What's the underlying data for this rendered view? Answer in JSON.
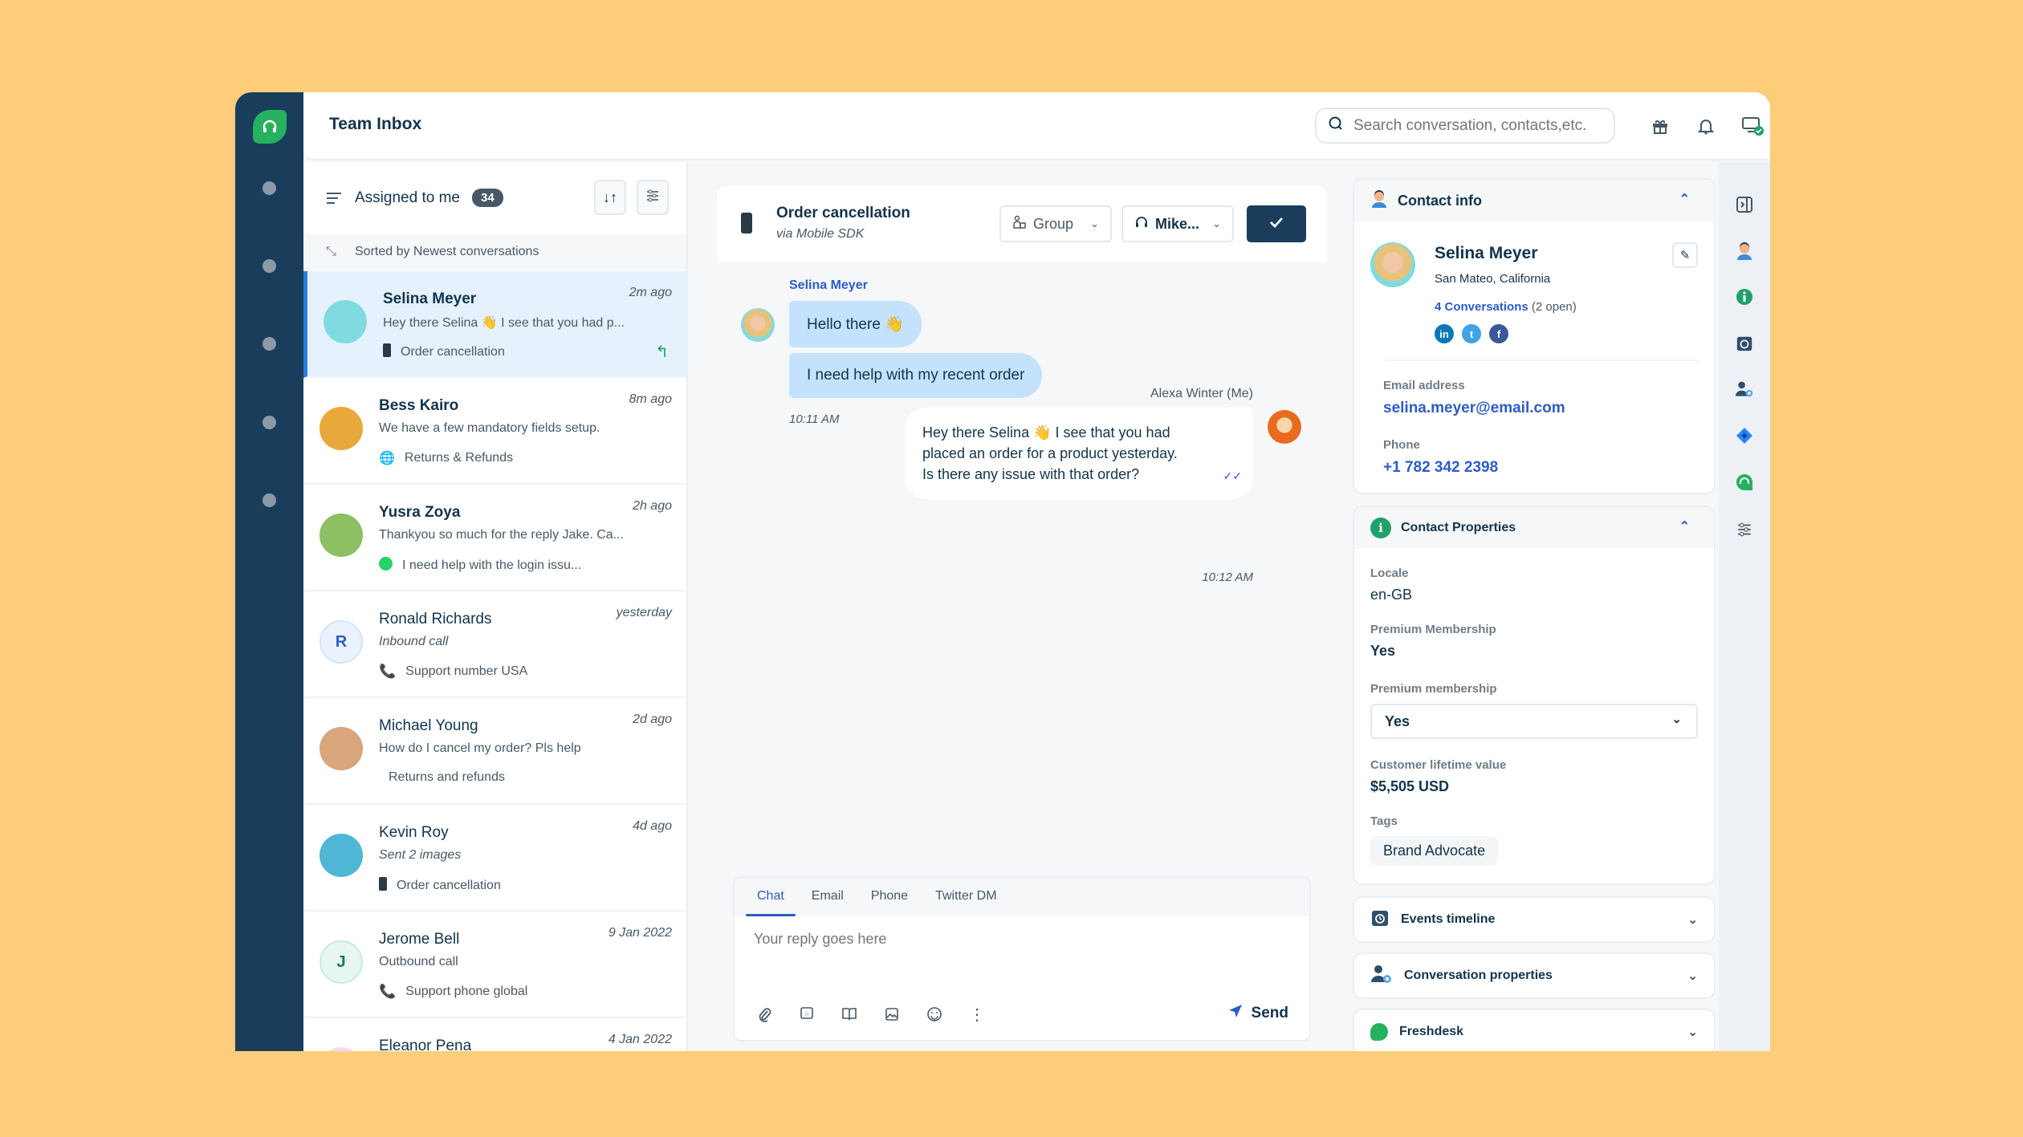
{
  "header": {
    "title": "Team Inbox",
    "search_placeholder": "Search conversation, contacts,etc.",
    "icons": [
      "gift-icon",
      "bell-icon",
      "status-monitor-icon",
      "user-avatar"
    ]
  },
  "nav": {
    "logo": "freshdesk-headset-logo",
    "items": [
      "nav-item-1",
      "nav-item-2",
      "nav-item-3",
      "nav-item-4",
      "nav-item-5"
    ]
  },
  "list": {
    "filter_label": "Assigned to me",
    "count": "34",
    "sort_label": "Sorted by Newest conversations",
    "conversations": [
      {
        "name": "Selina Meyer",
        "time": "2m ago",
        "preview": "Hey there Selina 👋 I see that you had p...",
        "channel_icon": "mobile-icon",
        "topic": "Order cancellation",
        "active": true,
        "bold": true,
        "avatar_color": "#7fdbe0"
      },
      {
        "name": "Bess Kairo",
        "time": "8m ago",
        "preview": "We have a few mandatory fields setup.",
        "channel_icon": "globe-icon",
        "topic": "Returns & Refunds",
        "bold": true,
        "avatar_color": "#e8a83a"
      },
      {
        "name": "Yusra Zoya",
        "time": "2h ago",
        "preview": "Thankyou so much for the reply Jake. Ca...",
        "channel_icon": "whatsapp-icon",
        "topic": "I need help with the login issu...",
        "bold": true,
        "avatar_color": "#8cc063"
      },
      {
        "name": "Ronald Richards",
        "time": "yesterday",
        "preview": "Inbound call",
        "channel_icon": "phone-icon",
        "topic": "Support number USA",
        "initial": "R",
        "italic": true,
        "avatar_color": "#eaf3fd"
      },
      {
        "name": "Michael Young",
        "time": "2d ago",
        "preview": "How do I cancel my order? Pls help",
        "channel_icon": "apple-icon",
        "topic": "Returns and refunds",
        "avatar_color": "#d9a57a"
      },
      {
        "name": "Kevin Roy",
        "time": "4d ago",
        "preview": "Sent 2 images",
        "channel_icon": "mobile-icon",
        "topic": "Order cancellation",
        "italic": true,
        "avatar_color": "#4fb6d6"
      },
      {
        "name": "Jerome Bell",
        "time": "9 Jan 2022",
        "preview": "Outbound call",
        "channel_icon": "phone-icon",
        "topic": "Support phone global",
        "initial": "J",
        "avatar_color": "#e6f7f2"
      },
      {
        "name": "Eleanor Pena",
        "time": "4 Jan 2022",
        "preview": "",
        "topic": "",
        "avatar_color": "#f5d9f2"
      }
    ]
  },
  "chat": {
    "title": "Order cancellation",
    "subtitle": "via Mobile SDK",
    "group_label": "Group",
    "agent_label": "Mike...",
    "messages": {
      "incoming_sender": "Selina Meyer",
      "incoming": [
        "Hello there 👋",
        "I need help with my recent order"
      ],
      "incoming_time": "10:11 AM",
      "outgoing_sender": "Alexa Winter (Me)",
      "outgoing_lines": [
        "Hey there Selina 👋 I see that you had",
        "placed an order for a product yesterday.",
        "Is there any issue with that order?"
      ],
      "outgoing_time": "10:12 AM"
    },
    "composer": {
      "tabs": [
        "Chat",
        "Email",
        "Phone",
        "Twitter DM"
      ],
      "active_tab": "Chat",
      "placeholder": "Your reply goes here",
      "send_label": "Send",
      "tools": [
        "attachment-icon",
        "canned-response-icon",
        "knowledge-base-icon",
        "image-icon",
        "emoji-icon",
        "more-icon"
      ]
    }
  },
  "contact": {
    "section_title": "Contact info",
    "name": "Selina Meyer",
    "location": "San Mateo, California",
    "conversations_link": "4 Conversations",
    "open_count": "(2 open)",
    "socials": [
      "linkedin",
      "twitter",
      "facebook"
    ],
    "email_label": "Email address",
    "email": "selina.meyer@email.com",
    "phone_label": "Phone",
    "phone": "+1 782 342 2398"
  },
  "properties": {
    "section_title": "Contact Properties",
    "locale_label": "Locale",
    "locale": "en-GB",
    "premium_label": "Premium Membership",
    "premium": "Yes",
    "premium_select_label": "Premium membership",
    "premium_select_value": "Yes",
    "clv_label": "Customer lifetime value",
    "clv": "$5,505 USD",
    "tags_label": "Tags",
    "tags": [
      "Brand Advocate"
    ]
  },
  "collapsed_sections": [
    "Events timeline",
    "Conversation properties",
    "Freshdesk"
  ],
  "strip_icons": [
    "collapse-panel-icon",
    "contact-info-icon",
    "info-icon",
    "events-timeline-icon",
    "conversation-properties-icon",
    "jira-icon",
    "freshdesk-icon",
    "settings-sliders-icon"
  ],
  "colors": {
    "background": "#fdcd7a",
    "nav": "#1a3d5c",
    "accent": "#2c5cc5",
    "brand_green": "#25b15e",
    "incoming_bubble": "#c5e2fc",
    "active_row": "#e5f2fd"
  }
}
